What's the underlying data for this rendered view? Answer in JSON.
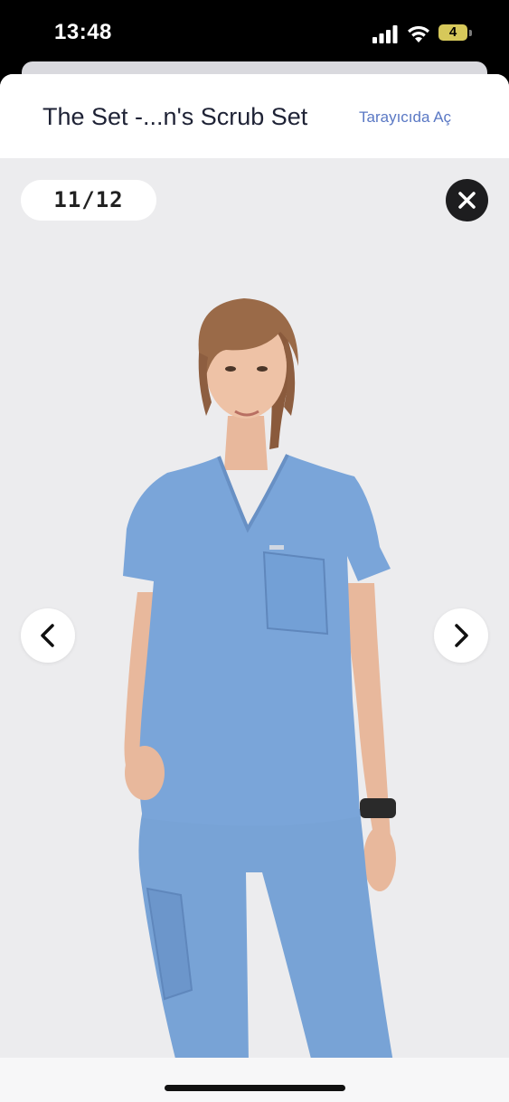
{
  "status_bar": {
    "time": "13:48",
    "battery_level": "4"
  },
  "sheet": {
    "title": "The Set -...n's Scrub Set",
    "open_in_browser": "Tarayıcıda Aç"
  },
  "viewer": {
    "counter": "11/12",
    "scrub_color": "#7aa5d9",
    "background_color": "#ececee"
  },
  "icons": {
    "close": "close-icon",
    "prev": "chevron-left-icon",
    "next": "chevron-right-icon",
    "signal": "cellular-signal-icon",
    "wifi": "wifi-icon",
    "battery": "battery-icon"
  }
}
